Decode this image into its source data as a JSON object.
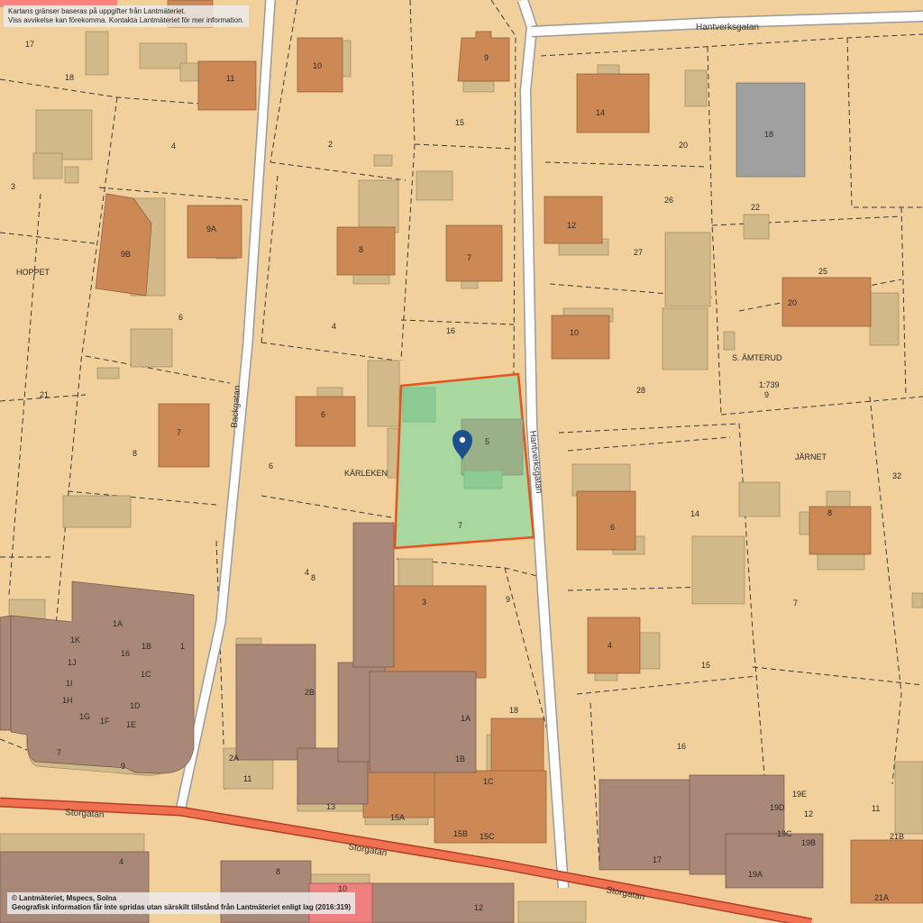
{
  "notice": {
    "line1": "Kartans gränser baseras på uppgifter från Lantmäteriet.",
    "line2": "Viss avvikelse kan förekomma. Kontakta Lantmäteriet för mer information."
  },
  "copyright": {
    "line1": "© Lantmäteriet, Mspecs, Solna",
    "line2": "Geografisk information får inte spridas utan särskilt tillstånd från Lantmäteriet enligt lag (2016:319)"
  },
  "streets": {
    "hantverksgatan_top": "Hantverksgatan",
    "hantverksgatan_side": "Hantverksgatan",
    "backgatan": "Backgatan",
    "storgatan_1": "Storgatan",
    "storgatan_2": "Storgatan",
    "storgatan_3": "Storgatan"
  },
  "districts": {
    "hoppet": "HOPPET",
    "karleken": "KÄRLEKEN",
    "jarnet": "JÄRNET",
    "samterud": "S. ÄMTERUD"
  },
  "selected_parcel": {
    "building_label": "5",
    "parcel_label": "7",
    "marker_icon": "location-pin-icon",
    "fill_color": "#a8d8a0",
    "border_color": "#e8521f"
  },
  "scale": {
    "parcel_code": "1:739",
    "parcel_num": "9"
  },
  "labels": {
    "l17": "17",
    "l18a": "18",
    "l3": "3",
    "l4a": "4",
    "l11a": "11",
    "l10a": "10",
    "l2": "2",
    "l9a": "9",
    "l15a": "15",
    "l14a": "14",
    "l20a": "20",
    "l18b": "18",
    "l9b": "9B",
    "l9c": "9A",
    "l8a": "8",
    "l7a": "7",
    "l12a": "12",
    "l26": "26",
    "l22": "22",
    "l27": "27",
    "l25": "25",
    "l6a": "6",
    "l4b": "4",
    "l16a": "16",
    "l10b": "10",
    "l20b": "20",
    "l21a": "21",
    "l28": "28",
    "l7b": "7",
    "l8b": "8",
    "l6b": "6",
    "l6c": "6",
    "l14b": "14",
    "l32": "32",
    "l8c": "8",
    "l6d": "6",
    "l4c": "4",
    "l8d": "8",
    "l3b": "3",
    "l9d": "9",
    "l7c": "7",
    "l4d": "4",
    "l15b": "15",
    "l1a": "1A",
    "l1k": "1K",
    "l16b": "16",
    "l1b": "1B",
    "l1": "1",
    "l1j": "1J",
    "l1c": "1C",
    "l1i": "1I",
    "l1h": "1H",
    "l1d": "1D",
    "l1g": "1G",
    "l1f": "1F",
    "l1e": "1E",
    "l7d": "7",
    "l9e": "9",
    "l2b": "2B",
    "l2a": "2A",
    "l11b": "11",
    "l13": "13",
    "l1a2": "1A",
    "l18c": "18",
    "l1b2": "1B",
    "l1c2": "1C",
    "l15a2": "15A",
    "l15b2": "15B",
    "l15c": "15C",
    "l16c": "16",
    "l19e": "19E",
    "l19d": "19D",
    "l12b": "12",
    "l19c": "19C",
    "l19b": "19B",
    "l11c": "11",
    "l21b": "21B",
    "l17b": "17",
    "l19a": "19A",
    "l21a2": "21A",
    "l4e": "4",
    "l8e": "8",
    "l10c": "10",
    "l12c": "12"
  }
}
